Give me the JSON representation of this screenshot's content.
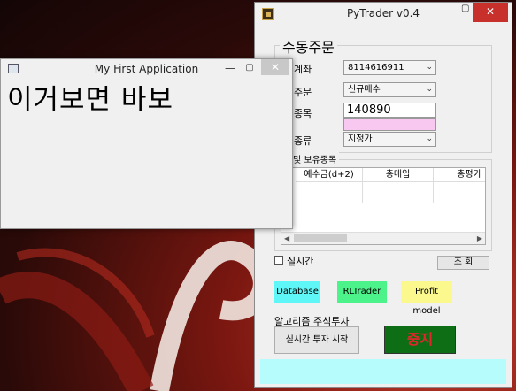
{
  "pytrader": {
    "title": "PyTrader v0.4",
    "minimize": "—",
    "close": "✕",
    "manual_order_group": "수동주문",
    "account_label": "계좌",
    "account_value": "8114616911",
    "order_label": "주문",
    "order_value": "신규매수",
    "code_label": "종목",
    "code_value": "140890",
    "code_name": "",
    "type_label": "종류",
    "type_value": "지정가",
    "holdings_group": "및 보유종목",
    "table_headers": [
      "예수금(d+2)",
      "총매입",
      "총평가"
    ],
    "realtime_label": "실시간",
    "query_button": "조 회",
    "database_button": "Database",
    "rltrader_button": "RLTrader",
    "profit_button": "Profit model",
    "algo_label": "알고리즘 주식투자",
    "start_button": "실시간 투자 시작",
    "stop_button": "중지",
    "colors": {
      "database": "#5ef6f6",
      "rltrader": "#4cf28a",
      "profit": "#fbf98d",
      "stop_bg": "#0e6e16",
      "stop_text": "#e3262a",
      "code_name_bg": "#f8c8f0",
      "status_bar": "#b6fcfc"
    }
  },
  "firstapp": {
    "title": "My First Application",
    "minimize": "—",
    "close": "✕",
    "label": "이거보면 바보"
  }
}
